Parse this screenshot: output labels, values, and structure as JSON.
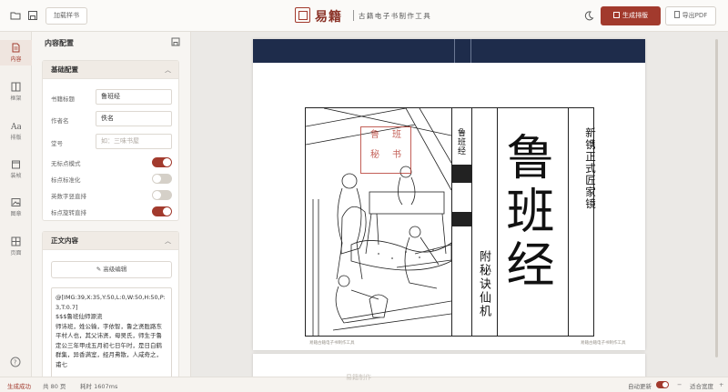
{
  "topbar": {
    "sample_button": "加载样书",
    "logo_title": "易籍",
    "logo_subtitle": "古籍电子书制作工具",
    "generate_button": "生成排版",
    "export_button": "导出PDF"
  },
  "rail": {
    "items": [
      {
        "label": "内容",
        "icon": "document-icon"
      },
      {
        "label": "框架",
        "icon": "frame-icon"
      },
      {
        "label": "排版",
        "icon": "typography-icon"
      },
      {
        "label": "装帧",
        "icon": "binding-icon"
      },
      {
        "label": "图章",
        "icon": "image-icon"
      },
      {
        "label": "页面",
        "icon": "grid-icon"
      }
    ],
    "help_icon": "help-icon"
  },
  "panel": {
    "title": "内容配置",
    "basic": {
      "title": "基础配置",
      "fields": [
        {
          "label": "书籍标题",
          "value": "鲁班经",
          "placeholder": ""
        },
        {
          "label": "作者名",
          "value": "佚名",
          "placeholder": ""
        },
        {
          "label": "堂号",
          "value": "",
          "placeholder": "如：三味书屋"
        }
      ],
      "toggles": [
        {
          "label": "无标点模式",
          "on": true
        },
        {
          "label": "标点标准化",
          "on": false
        },
        {
          "label": "英数字竖直排",
          "on": false
        },
        {
          "label": "标点旋转直排",
          "on": true
        }
      ]
    },
    "body": {
      "title": "正文内容",
      "edit_button": "高级编辑",
      "text": "@[IMG:39,X:35,Y:50,L:0,W:50,H:50,P:3,T:0.7]\n$$$鲁班仙师源流\n师讳班，姓公输，字依智，鲁之贤胜路东平村人也，其父讳贤，母吴氏，师生于鲁定公三年甲戌五月初七日午时，是日白鹤群集，异香满室，经月弗散，人咸奇之，甫七"
    }
  },
  "preview": {
    "spine_text": "鲁班经",
    "title": "鲁班经",
    "subtitle": "新镌正式匠家镜",
    "appendix": "附秘诀仙机",
    "seal_chars": [
      "鲁",
      "班",
      "秘",
      "书"
    ],
    "footer_left": "易籍古籍电子书制作工具",
    "footer_right": "易籍古籍电子书制作工具"
  },
  "status": {
    "state": "生成成功",
    "pages": "共 80 页",
    "time": "耗时 1607ms",
    "auto_refresh": "自动更新",
    "zoom_fit": "适合宽度",
    "watermark": "易籍制作"
  },
  "colors": {
    "accent": "#a23a2d",
    "band": "#1e2c4b",
    "panel_bg": "#f7f5f2"
  }
}
